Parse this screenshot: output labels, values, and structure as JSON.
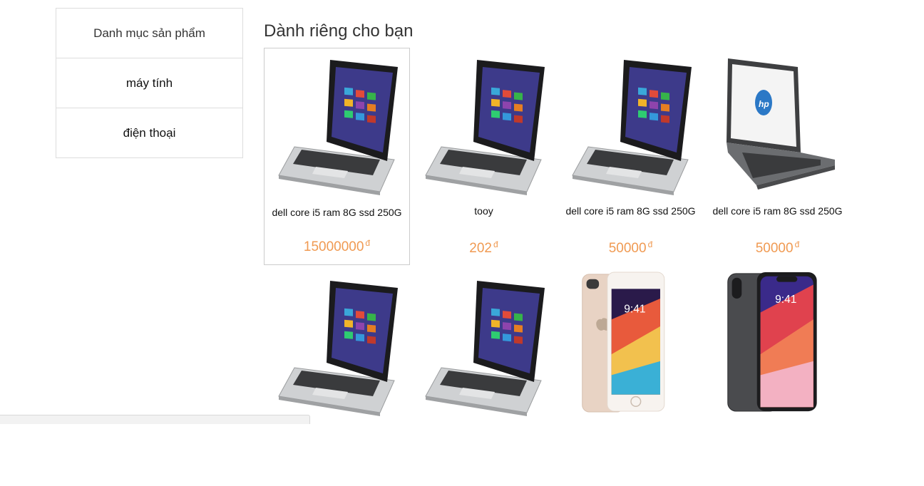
{
  "sidebar": {
    "items": [
      {
        "label": "Danh mục sản phẩm"
      },
      {
        "label": "máy tính"
      },
      {
        "label": "điện thoại"
      }
    ]
  },
  "section": {
    "title": "Dành riêng cho bạn"
  },
  "products": [
    {
      "name": "dell core i5 ram 8G ssd 250G",
      "price": "15000000",
      "currency": "đ",
      "image": "asus-laptop"
    },
    {
      "name": "tooy",
      "price": "202",
      "currency": "đ",
      "image": "asus-laptop"
    },
    {
      "name": "dell core i5 ram 8G ssd 250G",
      "price": "50000",
      "currency": "đ",
      "image": "asus-laptop"
    },
    {
      "name": "dell core i5 ram 8G ssd 250G",
      "price": "50000",
      "currency": "đ",
      "image": "hp-laptop"
    },
    {
      "name": "",
      "price": "",
      "currency": "",
      "image": "asus-laptop"
    },
    {
      "name": "",
      "price": "",
      "currency": "",
      "image": "asus-laptop"
    },
    {
      "name": "",
      "price": "",
      "currency": "",
      "image": "iphone-8-gold"
    },
    {
      "name": "",
      "price": "",
      "currency": "",
      "image": "iphone-x"
    }
  ],
  "colors": {
    "price": "#f09a52",
    "border": "#dddddd"
  }
}
